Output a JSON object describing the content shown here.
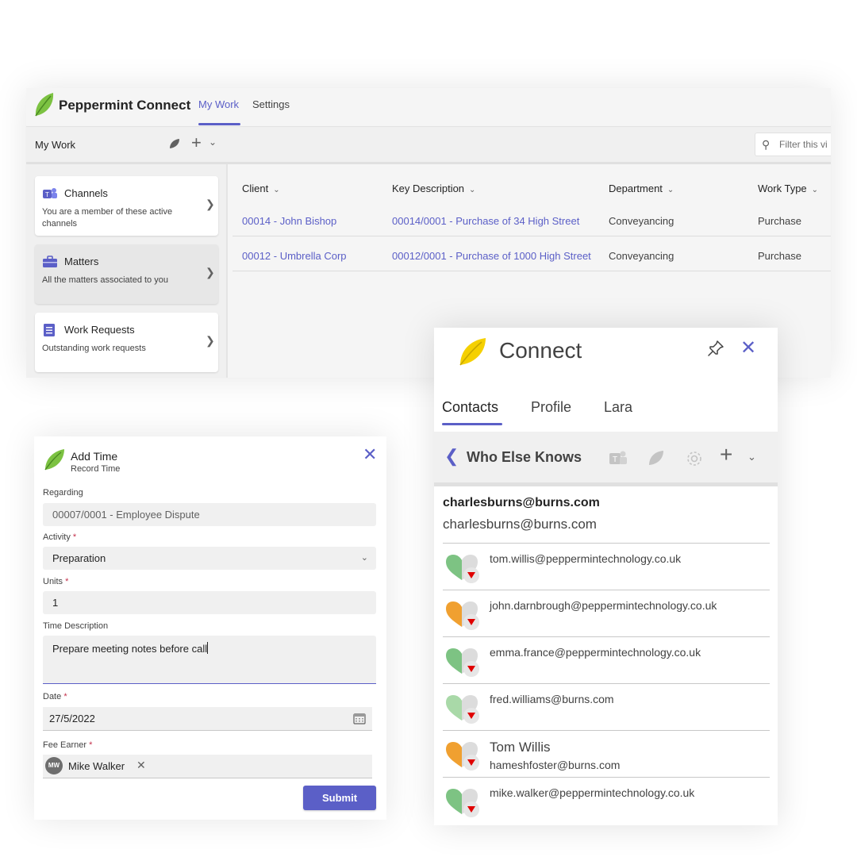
{
  "app": {
    "name": "Peppermint Connect",
    "tabs": [
      "My Work",
      "Settings"
    ],
    "active_tab": "My Work",
    "subbar_title": "My Work",
    "filter_placeholder": "Filter this vi",
    "sidebar": [
      {
        "title": "Channels",
        "description": "You are a member of these active channels",
        "icon": "teams-icon"
      },
      {
        "title": "Matters",
        "description": "All the matters associated to you",
        "icon": "briefcase-icon"
      },
      {
        "title": "Work Requests",
        "description": "Outstanding work requests",
        "icon": "document-icon"
      }
    ],
    "table": {
      "columns": [
        "Client",
        "Key Description",
        "Department",
        "Work Type"
      ],
      "rows": [
        [
          "00014 - John Bishop",
          "00014/0001 - Purchase of 34 High Street",
          "Conveyancing",
          "Purchase"
        ],
        [
          "00012 - Umbrella Corp",
          "00012/0001 - Purchase of 1000 High Street",
          "Conveyancing",
          "Purchase"
        ]
      ]
    }
  },
  "form": {
    "title": "Add Time",
    "subtitle": "Record Time",
    "regarding_label": "Regarding",
    "regarding_value": "00007/0001 - Employee Dispute",
    "activity_label": "Activity",
    "activity_value": "Preparation",
    "units_label": "Units",
    "units_value": "1",
    "time_description_label": "Time Description",
    "time_description_value": "Prepare meeting notes before call",
    "date_label": "Date",
    "date_value": "27/5/2022",
    "fee_earner_label": "Fee Earner",
    "fee_earner_initials": "MW",
    "fee_earner_name": "Mike Walker",
    "required_mark": "*",
    "submit_label": "Submit"
  },
  "connect": {
    "title": "Connect",
    "tabs": [
      "Contacts",
      "Profile",
      "Lara"
    ],
    "active_tab": "Contacts",
    "toolbar_title": "Who Else Knows",
    "contact_email_bold": "charlesburns@burns.com",
    "contact_email": "charlesburns@burns.com",
    "people": [
      {
        "name": "",
        "email": "tom.willis@peppermintechnology.co.uk",
        "heart": "green"
      },
      {
        "name": "",
        "email": "john.darnbrough@peppermintechnology.co.uk",
        "heart": "orange"
      },
      {
        "name": "",
        "email": "emma.france@peppermintechnology.co.uk",
        "heart": "green"
      },
      {
        "name": "",
        "email": "fred.williams@burns.com",
        "heart": "lightgreen"
      },
      {
        "name": "Tom Willis",
        "email": "hameshfoster@burns.com",
        "heart": "orange"
      },
      {
        "name": "",
        "email": "mike.walker@peppermintechnology.co.uk",
        "heart": "green"
      }
    ]
  },
  "colors": {
    "accent": "#5b5fc7",
    "leaf_green": "#7cc242",
    "leaf_yellow": "#f5d000",
    "heart_green": "#7dc383",
    "heart_orange": "#f0a030",
    "heart_lightgreen": "#a9d9a8",
    "down_arrow": "#e00000"
  }
}
